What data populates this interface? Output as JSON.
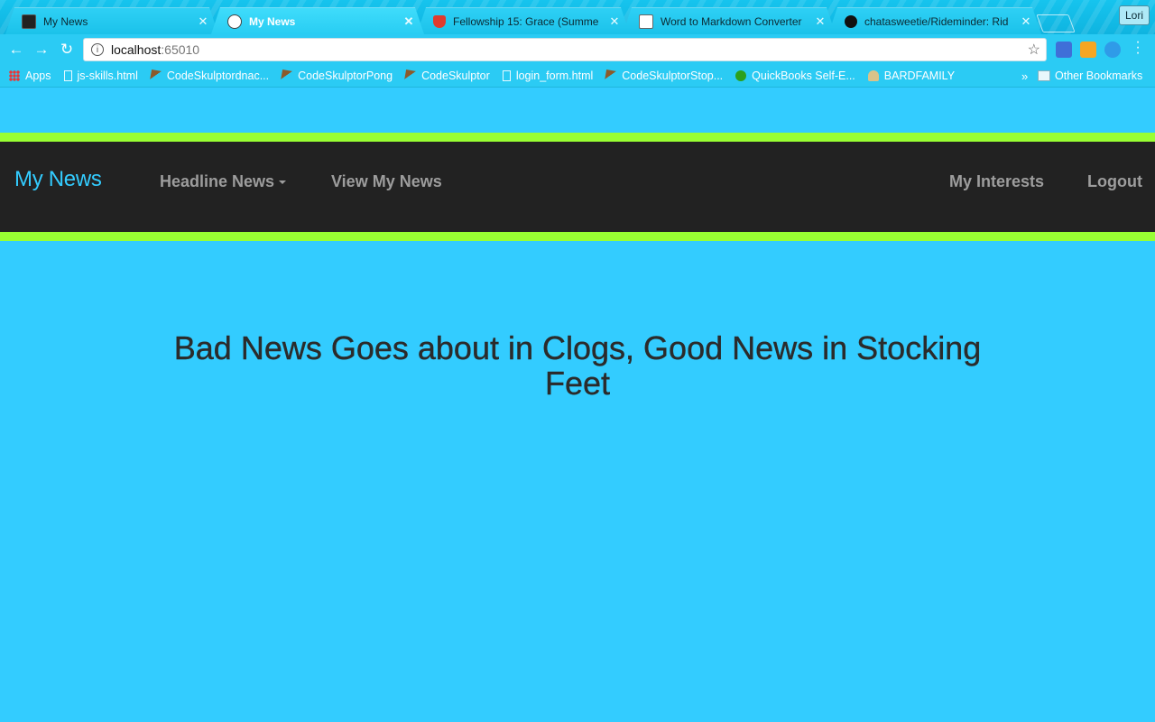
{
  "browser": {
    "tabs": [
      {
        "title": "My News",
        "icon": "terminal-icon",
        "active": false
      },
      {
        "title": "My News",
        "icon": "reddit-icon",
        "active": true
      },
      {
        "title": "Fellowship 15: Grace (Summe",
        "icon": "shield-icon",
        "active": false
      },
      {
        "title": "Word to Markdown Converter",
        "icon": "document-icon",
        "active": false
      },
      {
        "title": "chatasweetie/Rideminder: Rid",
        "icon": "github-icon",
        "active": false
      }
    ],
    "profile_name": "Lori",
    "address": {
      "host": "localhost",
      "port": ":65010"
    },
    "bookmarks": [
      {
        "label": "Apps",
        "icon": "apps-icon"
      },
      {
        "label": "js-skills.html",
        "icon": "document-icon"
      },
      {
        "label": "CodeSkulptordnac...",
        "icon": "hammer-icon"
      },
      {
        "label": "CodeSkulptorPong",
        "icon": "hammer-icon"
      },
      {
        "label": "CodeSkulptor",
        "icon": "hammer-icon"
      },
      {
        "label": "login_form.html",
        "icon": "document-icon"
      },
      {
        "label": "CodeSkulptorStop...",
        "icon": "hammer-icon"
      },
      {
        "label": "QuickBooks Self-E...",
        "icon": "quickbooks-icon"
      },
      {
        "label": "BARDFAMILY",
        "icon": "family-tree-icon"
      }
    ],
    "bookmarks_more": "»",
    "other_bookmarks": "Other Bookmarks"
  },
  "navbar": {
    "brand": "My News",
    "headline_news": "Headline News",
    "view_my_news": "View My News",
    "my_interests": "My Interests",
    "logout": "Logout"
  },
  "main": {
    "headline": "Bad News Goes about in Clogs, Good News in Stocking Feet"
  },
  "colors": {
    "page_background": "#33ccff",
    "navbar_background": "#222222",
    "navbar_border": "#99ff33",
    "brand": "#33ccff",
    "nav_link": "#9d9d9d",
    "headline_text": "#2b2b2b"
  }
}
